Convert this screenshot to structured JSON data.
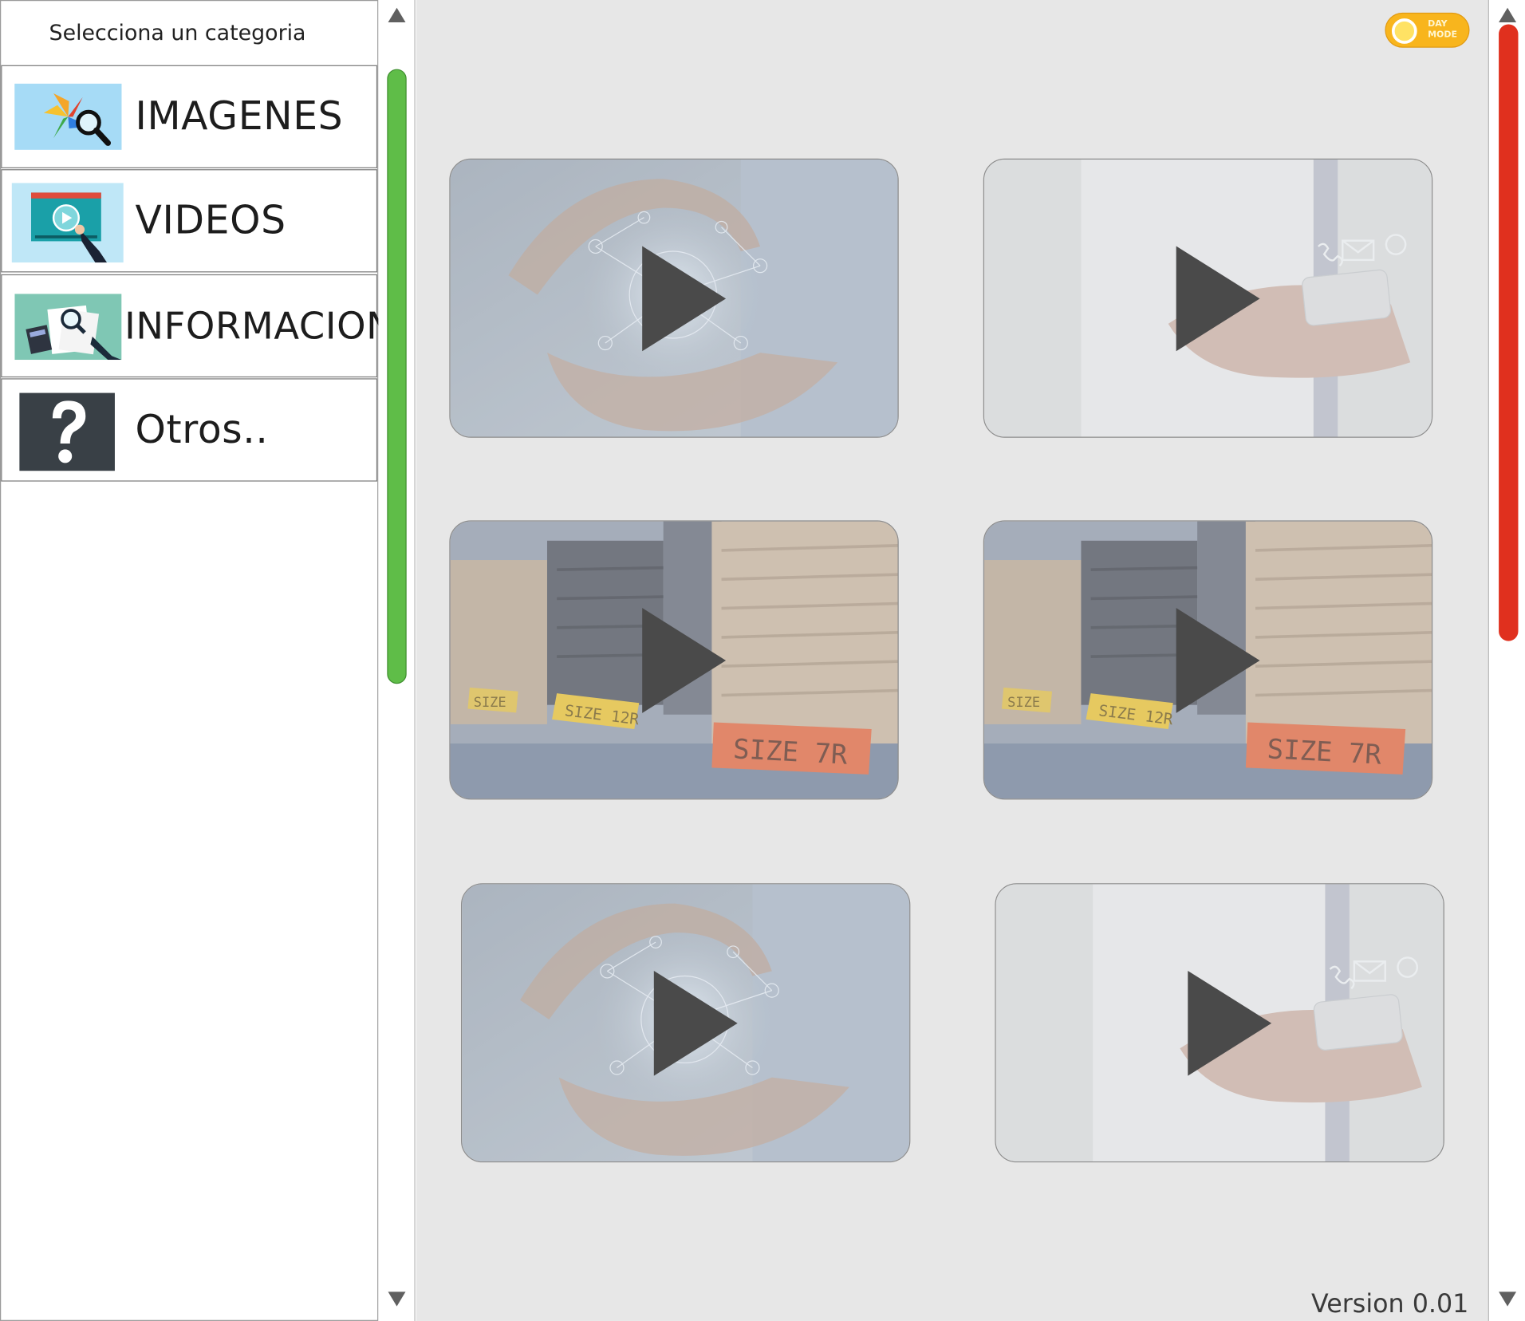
{
  "sidebar": {
    "header": "Selecciona un categoria",
    "items": [
      {
        "label": "IMAGENES",
        "icon": "photos-search-icon"
      },
      {
        "label": "VIDEOS",
        "icon": "video-player-icon"
      },
      {
        "label": "INFORMACION",
        "icon": "documents-magnifier-icon"
      },
      {
        "label": "Otros..",
        "icon": "question-mark-icon"
      }
    ]
  },
  "toggle": {
    "line1": "DAY",
    "line2": "MODE"
  },
  "videos": [
    {
      "thumbnail": "hands-network-globe",
      "icon": "play-icon"
    },
    {
      "thumbnail": "hand-smartphone-contact-icons",
      "icon": "play-icon"
    },
    {
      "thumbnail": "clothes-stacks-size-tags",
      "icon": "play-icon"
    },
    {
      "thumbnail": "clothes-stacks-size-tags",
      "icon": "play-icon"
    },
    {
      "thumbnail": "hands-network-globe",
      "icon": "play-icon"
    },
    {
      "thumbnail": "hand-smartphone-contact-icons",
      "icon": "play-icon"
    }
  ],
  "clothes_tags": {
    "big": "SIZE 7R",
    "small": "SIZE 12R",
    "tiny": "SIZE"
  },
  "version": "Version 0.01",
  "colors": {
    "sidebar_scroll_thumb": "#5fbd48",
    "main_scroll_thumb": "#e0301e",
    "toggle": "#f8b51d",
    "main_bg": "#e7e7e7"
  }
}
